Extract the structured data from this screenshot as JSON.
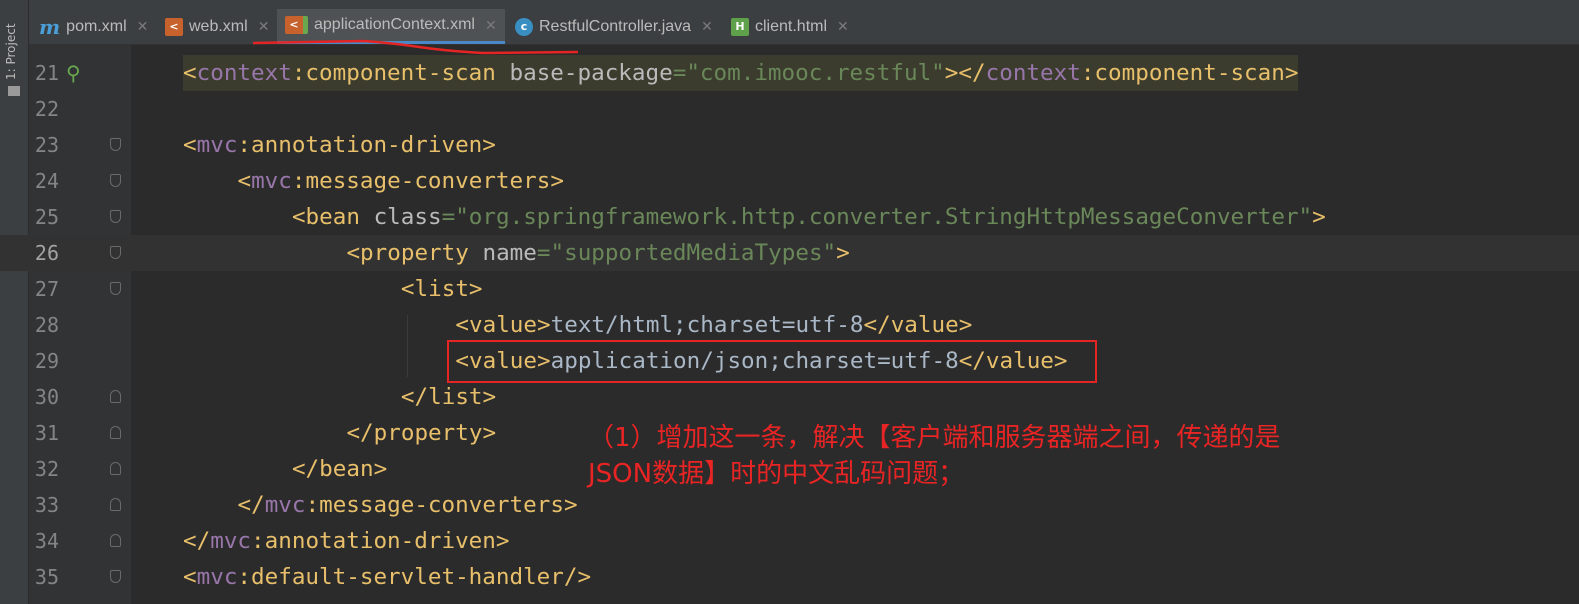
{
  "sidebar": {
    "project_label": "1: Project"
  },
  "tabs": [
    {
      "label": "pom.xml",
      "icon": "maven-icon",
      "active": false
    },
    {
      "label": "web.xml",
      "icon": "xml-web-icon",
      "active": false
    },
    {
      "label": "applicationContext.xml",
      "icon": "spring-xml-icon",
      "active": true
    },
    {
      "label": "RestfulController.java",
      "icon": "java-class-icon",
      "active": false
    },
    {
      "label": "client.html",
      "icon": "html-icon",
      "active": false
    }
  ],
  "editor": {
    "current_line": 26,
    "lines": [
      {
        "n": "21",
        "indent": 0,
        "hl": true,
        "t": [
          [
            "b",
            "<"
          ],
          [
            "ns",
            "context"
          ],
          [
            "b",
            ":component-scan "
          ],
          [
            "at",
            "base-package"
          ],
          [
            "s",
            "=\"com.imooc.restful\""
          ],
          [
            "b",
            ">"
          ],
          [
            "b",
            "</"
          ],
          [
            "ns",
            "context"
          ],
          [
            "b",
            ":component-scan>"
          ]
        ]
      },
      {
        "n": "22",
        "indent": 0,
        "t": []
      },
      {
        "n": "23",
        "indent": 0,
        "t": [
          [
            "b",
            "<"
          ],
          [
            "ns",
            "mvc"
          ],
          [
            "b",
            ":annotation-driven>"
          ]
        ]
      },
      {
        "n": "24",
        "indent": 1,
        "t": [
          [
            "b",
            "<"
          ],
          [
            "ns",
            "mvc"
          ],
          [
            "b",
            ":message-converters>"
          ]
        ]
      },
      {
        "n": "25",
        "indent": 2,
        "t": [
          [
            "b",
            "<bean "
          ],
          [
            "at",
            "class"
          ],
          [
            "s",
            "=\"org.springframework.http.converter.StringHttpMessageConverter\""
          ],
          [
            "b",
            ">"
          ]
        ]
      },
      {
        "n": "26",
        "indent": 3,
        "t": [
          [
            "b",
            "<property "
          ],
          [
            "at",
            "name"
          ],
          [
            "s",
            "=\"supportedMediaTypes\""
          ],
          [
            "b",
            ">"
          ]
        ]
      },
      {
        "n": "27",
        "indent": 4,
        "t": [
          [
            "b",
            "<list>"
          ]
        ]
      },
      {
        "n": "28",
        "indent": 5,
        "t": [
          [
            "b",
            "<value>"
          ],
          [
            "p",
            "text/html;charset=utf-8"
          ],
          [
            "b",
            "</value>"
          ]
        ]
      },
      {
        "n": "29",
        "indent": 5,
        "t": [
          [
            "b",
            "<value>"
          ],
          [
            "p",
            "application/json;charset=utf-8"
          ],
          [
            "b",
            "</value>"
          ]
        ]
      },
      {
        "n": "30",
        "indent": 4,
        "t": [
          [
            "b",
            "</list>"
          ]
        ]
      },
      {
        "n": "31",
        "indent": 3,
        "t": [
          [
            "b",
            "</property>"
          ]
        ]
      },
      {
        "n": "32",
        "indent": 2,
        "t": [
          [
            "b",
            "</bean>"
          ]
        ]
      },
      {
        "n": "33",
        "indent": 1,
        "t": [
          [
            "b",
            "</"
          ],
          [
            "ns",
            "mvc"
          ],
          [
            "b",
            ":message-converters>"
          ]
        ]
      },
      {
        "n": "34",
        "indent": 0,
        "t": [
          [
            "b",
            "</"
          ],
          [
            "ns",
            "mvc"
          ],
          [
            "b",
            ":annotation-driven>"
          ]
        ]
      },
      {
        "n": "35",
        "indent": 0,
        "t": [
          [
            "b",
            "<"
          ],
          [
            "ns",
            "mvc"
          ],
          [
            "b",
            ":default-servlet-handler/>"
          ]
        ]
      }
    ]
  },
  "annotation": {
    "note": "（1）增加这一条，解决【客户端和服务器端之间，传递的是JSON数据】时的中文乱码问题；"
  },
  "colors": {
    "accent": "#4a88c7",
    "annotation": "#e82424"
  }
}
